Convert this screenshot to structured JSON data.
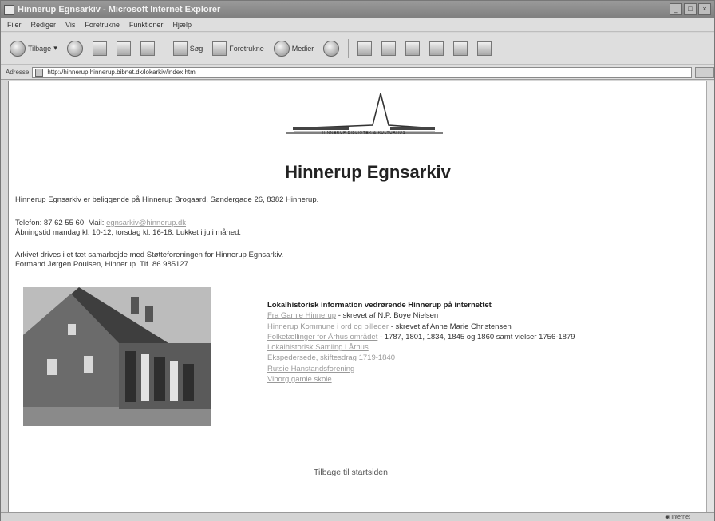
{
  "window": {
    "title": "Hinnerup Egnsarkiv - Microsoft Internet Explorer"
  },
  "menu": [
    "Filer",
    "Rediger",
    "Vis",
    "Foretrukne",
    "Funktioner",
    "Hjælp"
  ],
  "toolbar": {
    "back": "Tilbage",
    "search": "Søg",
    "favorites": "Foretrukne",
    "media": "Medier"
  },
  "address": {
    "label": "Adresse",
    "url": "http://hinnerup.hinnerup.bibnet.dk/lokarkiv/index.htm"
  },
  "page": {
    "logo_caption": "HINNERUP BIBLIOTEK & KULTURHUS",
    "title": "Hinnerup Egnsarkiv",
    "intro": "Hinnerup Egnsarkiv er beliggende på Hinnerup Brogaard, Søndergade 26, 8382 Hinnerup.",
    "contact_prefix": "Telefon: 87 62 55 60. Mail:",
    "email": "egnsarkiv@hinnerup.dk",
    "hours": "Åbningstid mandag kl. 10-12, torsdag kl. 16-18. Lukket i juli måned.",
    "operated_by": "Arkivet drives i et tæt samarbejde med Støtteforeningen for Hinnerup Egnsarkiv.",
    "chairman": "Formand Jørgen Poulsen, Hinnerup. Tlf. 86 985127",
    "info_heading": "Lokalhistorisk information vedrørende Hinnerup på internettet",
    "links": [
      {
        "link": "Fra Gamle Hinnerup",
        "suffix": " - skrevet af N.P. Boye Nielsen"
      },
      {
        "link": "Hinnerup Kommune i ord og billeder",
        "suffix": " - skrevet af Anne Marie Christensen"
      },
      {
        "link": "Folketællinger for Århus området",
        "suffix": " - 1787, 1801, 1834, 1845 og 1860 samt vielser 1756-1879"
      },
      {
        "link": "Lokalhistorisk Samling i Århus",
        "suffix": ""
      },
      {
        "link": "Ekspedersede, skiftesdrag 1719-1840",
        "suffix": ""
      },
      {
        "link": "Rutsie Hanstandsforening",
        "suffix": ""
      },
      {
        "link": "Viborg gamle skole",
        "suffix": ""
      }
    ],
    "back_link": "Tilbage til startsiden"
  },
  "status": {
    "zone": "Internet"
  },
  "colors": {
    "link": "#999999",
    "background": "#ffffff"
  }
}
